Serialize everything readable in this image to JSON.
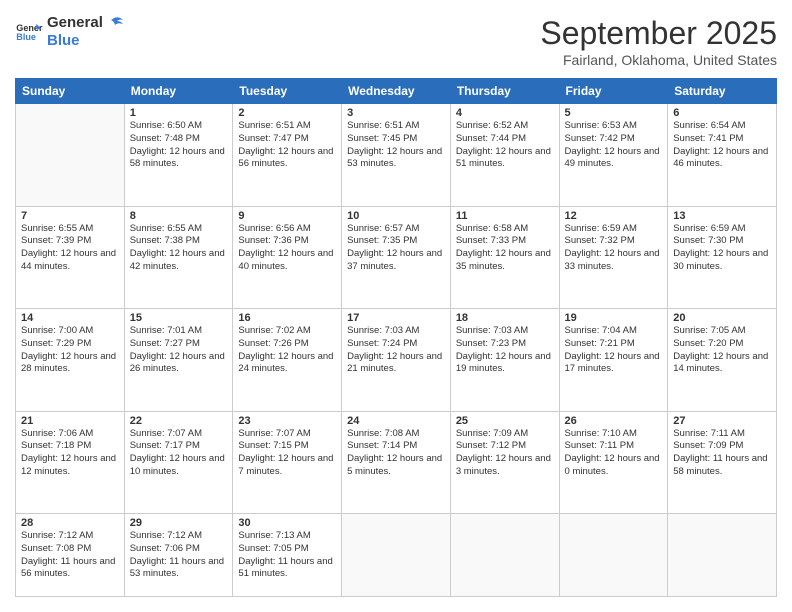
{
  "header": {
    "logo_general": "General",
    "logo_blue": "Blue",
    "title": "September 2025",
    "location": "Fairland, Oklahoma, United States"
  },
  "days_of_week": [
    "Sunday",
    "Monday",
    "Tuesday",
    "Wednesday",
    "Thursday",
    "Friday",
    "Saturday"
  ],
  "weeks": [
    [
      {
        "day": "",
        "empty": true
      },
      {
        "day": "1",
        "sunrise": "6:50 AM",
        "sunset": "7:48 PM",
        "daylight": "12 hours and 58 minutes."
      },
      {
        "day": "2",
        "sunrise": "6:51 AM",
        "sunset": "7:47 PM",
        "daylight": "12 hours and 56 minutes."
      },
      {
        "day": "3",
        "sunrise": "6:51 AM",
        "sunset": "7:45 PM",
        "daylight": "12 hours and 53 minutes."
      },
      {
        "day": "4",
        "sunrise": "6:52 AM",
        "sunset": "7:44 PM",
        "daylight": "12 hours and 51 minutes."
      },
      {
        "day": "5",
        "sunrise": "6:53 AM",
        "sunset": "7:42 PM",
        "daylight": "12 hours and 49 minutes."
      },
      {
        "day": "6",
        "sunrise": "6:54 AM",
        "sunset": "7:41 PM",
        "daylight": "12 hours and 46 minutes."
      }
    ],
    [
      {
        "day": "7",
        "sunrise": "6:55 AM",
        "sunset": "7:39 PM",
        "daylight": "12 hours and 44 minutes."
      },
      {
        "day": "8",
        "sunrise": "6:55 AM",
        "sunset": "7:38 PM",
        "daylight": "12 hours and 42 minutes."
      },
      {
        "day": "9",
        "sunrise": "6:56 AM",
        "sunset": "7:36 PM",
        "daylight": "12 hours and 40 minutes."
      },
      {
        "day": "10",
        "sunrise": "6:57 AM",
        "sunset": "7:35 PM",
        "daylight": "12 hours and 37 minutes."
      },
      {
        "day": "11",
        "sunrise": "6:58 AM",
        "sunset": "7:33 PM",
        "daylight": "12 hours and 35 minutes."
      },
      {
        "day": "12",
        "sunrise": "6:59 AM",
        "sunset": "7:32 PM",
        "daylight": "12 hours and 33 minutes."
      },
      {
        "day": "13",
        "sunrise": "6:59 AM",
        "sunset": "7:30 PM",
        "daylight": "12 hours and 30 minutes."
      }
    ],
    [
      {
        "day": "14",
        "sunrise": "7:00 AM",
        "sunset": "7:29 PM",
        "daylight": "12 hours and 28 minutes."
      },
      {
        "day": "15",
        "sunrise": "7:01 AM",
        "sunset": "7:27 PM",
        "daylight": "12 hours and 26 minutes."
      },
      {
        "day": "16",
        "sunrise": "7:02 AM",
        "sunset": "7:26 PM",
        "daylight": "12 hours and 24 minutes."
      },
      {
        "day": "17",
        "sunrise": "7:03 AM",
        "sunset": "7:24 PM",
        "daylight": "12 hours and 21 minutes."
      },
      {
        "day": "18",
        "sunrise": "7:03 AM",
        "sunset": "7:23 PM",
        "daylight": "12 hours and 19 minutes."
      },
      {
        "day": "19",
        "sunrise": "7:04 AM",
        "sunset": "7:21 PM",
        "daylight": "12 hours and 17 minutes."
      },
      {
        "day": "20",
        "sunrise": "7:05 AM",
        "sunset": "7:20 PM",
        "daylight": "12 hours and 14 minutes."
      }
    ],
    [
      {
        "day": "21",
        "sunrise": "7:06 AM",
        "sunset": "7:18 PM",
        "daylight": "12 hours and 12 minutes."
      },
      {
        "day": "22",
        "sunrise": "7:07 AM",
        "sunset": "7:17 PM",
        "daylight": "12 hours and 10 minutes."
      },
      {
        "day": "23",
        "sunrise": "7:07 AM",
        "sunset": "7:15 PM",
        "daylight": "12 hours and 7 minutes."
      },
      {
        "day": "24",
        "sunrise": "7:08 AM",
        "sunset": "7:14 PM",
        "daylight": "12 hours and 5 minutes."
      },
      {
        "day": "25",
        "sunrise": "7:09 AM",
        "sunset": "7:12 PM",
        "daylight": "12 hours and 3 minutes."
      },
      {
        "day": "26",
        "sunrise": "7:10 AM",
        "sunset": "7:11 PM",
        "daylight": "12 hours and 0 minutes."
      },
      {
        "day": "27",
        "sunrise": "7:11 AM",
        "sunset": "7:09 PM",
        "daylight": "11 hours and 58 minutes."
      }
    ],
    [
      {
        "day": "28",
        "sunrise": "7:12 AM",
        "sunset": "7:08 PM",
        "daylight": "11 hours and 56 minutes."
      },
      {
        "day": "29",
        "sunrise": "7:12 AM",
        "sunset": "7:06 PM",
        "daylight": "11 hours and 53 minutes."
      },
      {
        "day": "30",
        "sunrise": "7:13 AM",
        "sunset": "7:05 PM",
        "daylight": "11 hours and 51 minutes."
      },
      {
        "day": "",
        "empty": true
      },
      {
        "day": "",
        "empty": true
      },
      {
        "day": "",
        "empty": true
      },
      {
        "day": "",
        "empty": true
      }
    ]
  ]
}
